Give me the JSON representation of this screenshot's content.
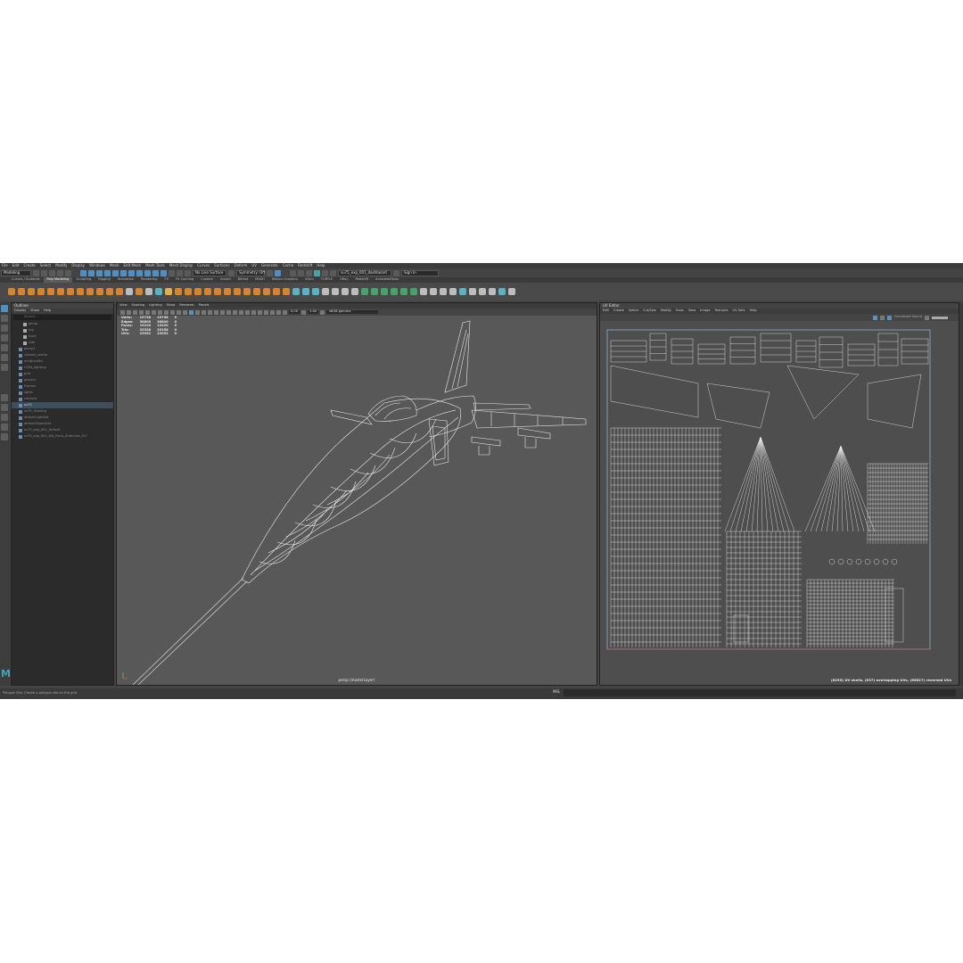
{
  "menubar": [
    "File",
    "Edit",
    "Create",
    "Select",
    "Modify",
    "Display",
    "Windows",
    "Mesh",
    "Edit Mesh",
    "Mesh Tools",
    "Mesh Display",
    "Curves",
    "Surfaces",
    "Deform",
    "UV",
    "Generate",
    "Cache",
    "Redshift",
    "Help"
  ],
  "statusline": {
    "mode": "Modeling",
    "live_surface": "No Live Surface",
    "symmetry": "Symmetry: Off",
    "workspace": "su75_exp_001_dashboard",
    "sign_in": "Sign In"
  },
  "shelf_tabs": {
    "items": [
      "Curves / Surfaces",
      "Poly Modeling",
      "Sculpting",
      "Rigging",
      "Animation",
      "Rendering",
      "FX",
      "FX Caching",
      "Custom",
      "Arnold",
      "Bifrost",
      "MASH",
      "Motion Graphics",
      "XGen",
      "TURTLE",
      "VRay",
      "Redshift",
      "AnimatedTools"
    ],
    "active": "Poly Modeling"
  },
  "outliner": {
    "title": "Outliner",
    "menu": [
      "Display",
      "Show",
      "Help"
    ],
    "search_placeholder": "Search...",
    "items": [
      {
        "label": "persp",
        "type": "cam",
        "indent": 1
      },
      {
        "label": "top",
        "type": "cam",
        "indent": 1
      },
      {
        "label": "front",
        "type": "cam",
        "indent": 1
      },
      {
        "label": "side",
        "type": "cam",
        "indent": 1
      },
      {
        "label": "persp1",
        "type": "grp",
        "indent": 0
      },
      {
        "label": "chassis_center",
        "type": "grp",
        "indent": 0
      },
      {
        "label": "antigravitbl",
        "type": "grp",
        "indent": 0
      },
      {
        "label": "LODs_lighting",
        "type": "grp",
        "indent": 0
      },
      {
        "label": "grid",
        "type": "grp",
        "indent": 0
      },
      {
        "label": "ground",
        "type": "grp",
        "indent": 0
      },
      {
        "label": "Frames",
        "type": "grp",
        "indent": 0
      },
      {
        "label": "lights",
        "type": "grp",
        "indent": 0
      },
      {
        "label": "controls",
        "type": "grp",
        "indent": 0
      },
      {
        "label": "su75",
        "type": "grp",
        "indent": 0,
        "selected": true
      },
      {
        "label": "su75_Shading",
        "type": "grp",
        "indent": 0
      },
      {
        "label": "defaultLightSet",
        "type": "set",
        "indent": 0
      },
      {
        "label": "defaultObjectSet",
        "type": "set",
        "indent": 0
      },
      {
        "label": "su75_exp_001_Default",
        "type": "grp",
        "indent": 0
      },
      {
        "label": "su75_exp_001_Bid_Front_Antennas_UV",
        "type": "grp",
        "indent": 0
      }
    ]
  },
  "viewport": {
    "menu": [
      "View",
      "Shading",
      "Lighting",
      "Show",
      "Renderer",
      "Panels"
    ],
    "gamma_field": "0.00",
    "exposure_field": "1.00",
    "colorspace": "sRGB gamma",
    "hud": [
      {
        "label": "Verts:",
        "a": "19738",
        "b": "19738",
        "c": "0"
      },
      {
        "label": "Edges:",
        "a": "38800",
        "b": "38800",
        "c": "0"
      },
      {
        "label": "Faces:",
        "a": "19220",
        "b": "19220",
        "c": "0"
      },
      {
        "label": "Tris:",
        "a": "35358",
        "b": "35358",
        "c": "0"
      },
      {
        "label": "UVs:",
        "a": "23952",
        "b": "23952",
        "c": "0"
      }
    ],
    "camera_label": "persp (masterLayer)"
  },
  "uv_editor": {
    "title": "UV Editor",
    "menu": [
      "Edit",
      "Create",
      "Select",
      "Cut/Sew",
      "Modify",
      "Tools",
      "View",
      "Image",
      "Textures",
      "UV Sets",
      "Help"
    ],
    "tb_text": "Checkered Sound",
    "status": "(6295) UV shells, (637) overlapping UVs, (65827) reversed UVs"
  },
  "helpline": {
    "text": "Polygon Sits: Create a polygon sits on the grid.",
    "mel_label": "MEL"
  },
  "logo": "M",
  "colors": {
    "accent": "#4f8fc2",
    "background": "#444444",
    "viewport": "#585858",
    "wire": "#e8e8e8"
  }
}
